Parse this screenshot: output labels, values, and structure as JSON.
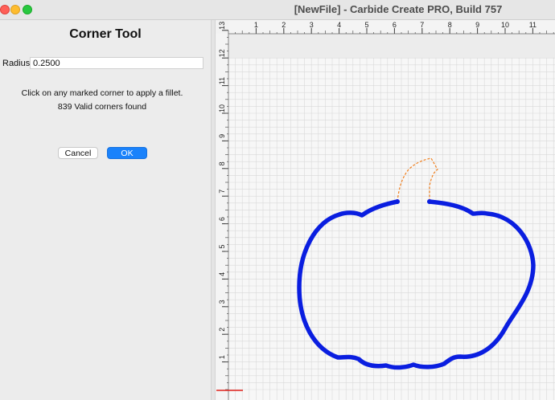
{
  "window": {
    "title": "[NewFile] - Carbide Create PRO, Build 757",
    "controls": [
      "close-icon",
      "minimize-icon",
      "maximize-icon"
    ]
  },
  "corner_tool": {
    "title": "Corner Tool",
    "radius_label": "Radius",
    "radius_value": "0.2500",
    "instruction": "Click on any marked corner to apply a fillet.",
    "status": "839 Valid corners found",
    "cancel_label": "Cancel",
    "ok_label": "OK"
  },
  "ruler": {
    "x_ticks": [
      "1",
      "2",
      "3",
      "4",
      "5",
      "6",
      "7",
      "8",
      "9",
      "10",
      "11",
      "12"
    ],
    "y_ticks": [
      "13",
      "12",
      "11",
      "10",
      "9",
      "8",
      "7",
      "6",
      "5",
      "4",
      "3",
      "2",
      "1"
    ]
  },
  "colors": {
    "shape_stroke": "#0a1ee0",
    "stem_stroke": "#f07f1e",
    "grid_minor": "#d9d9d9",
    "grid_major": "#bdbdbd",
    "ok_button": "#1a82fb"
  }
}
